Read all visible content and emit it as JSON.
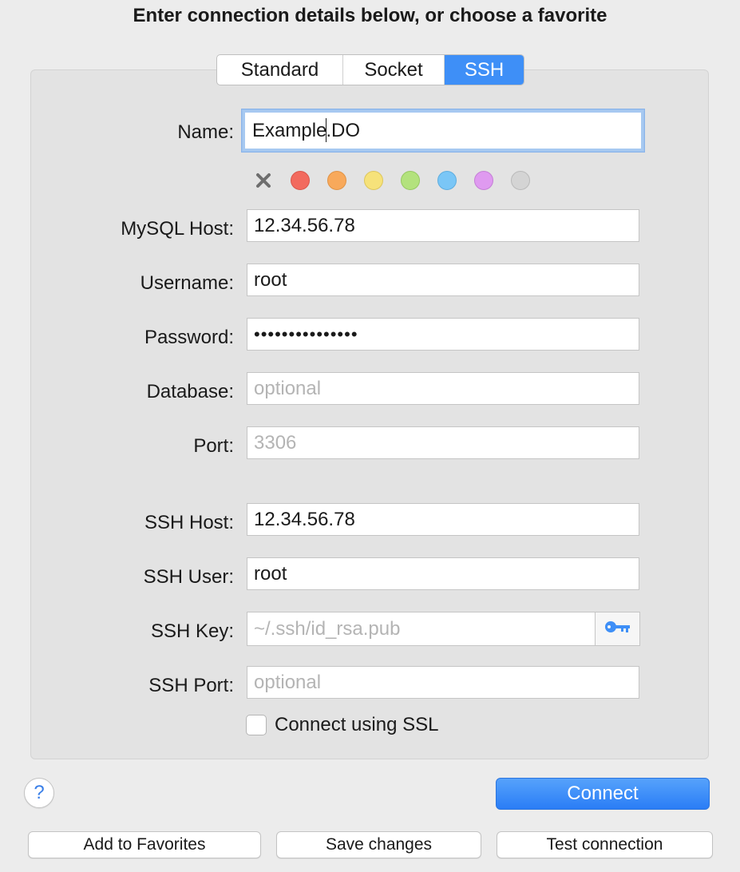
{
  "heading": "Enter connection details below, or choose a favorite",
  "tabs": [
    {
      "label": "Standard",
      "selected": false
    },
    {
      "label": "Socket",
      "selected": false
    },
    {
      "label": "SSH",
      "selected": true
    }
  ],
  "accent_color": "#3e8ff7",
  "form": {
    "name": {
      "label": "Name:",
      "value_before_caret": "Example",
      "value_after_caret": ".DO"
    },
    "colors": {
      "clear_icon": "close-icon",
      "swatches": [
        {
          "name": "red",
          "fill": "#f26a5e",
          "border": "#d9564b"
        },
        {
          "name": "orange",
          "fill": "#f8a95b",
          "border": "#e09346"
        },
        {
          "name": "yellow",
          "fill": "#f6e27a",
          "border": "#ddc65c"
        },
        {
          "name": "green",
          "fill": "#b3e27d",
          "border": "#97c862"
        },
        {
          "name": "blue",
          "fill": "#7ac6f6",
          "border": "#5eaddf"
        },
        {
          "name": "purple",
          "fill": "#df9af0",
          "border": "#c47fd6"
        },
        {
          "name": "gray",
          "fill": "#d4d4d4",
          "border": "#b9b9b9"
        }
      ]
    },
    "mysql_host": {
      "label": "MySQL Host:",
      "value": "12.34.56.78",
      "placeholder": ""
    },
    "username": {
      "label": "Username:",
      "value": "root",
      "placeholder": ""
    },
    "password": {
      "label": "Password:",
      "value": "•••••••••••••••",
      "placeholder": ""
    },
    "database": {
      "label": "Database:",
      "value": "",
      "placeholder": "optional"
    },
    "port": {
      "label": "Port:",
      "value": "",
      "placeholder": "3306"
    },
    "ssh_host": {
      "label": "SSH Host:",
      "value": "12.34.56.78",
      "placeholder": ""
    },
    "ssh_user": {
      "label": "SSH User:",
      "value": "root",
      "placeholder": ""
    },
    "ssh_key": {
      "label": "SSH Key:",
      "value": "",
      "placeholder": "~/.ssh/id_rsa.pub",
      "button_icon": "key-icon"
    },
    "ssh_port": {
      "label": "SSH Port:",
      "value": "",
      "placeholder": "optional"
    },
    "ssl": {
      "label": "Connect using SSL",
      "checked": false
    }
  },
  "buttons": {
    "help": "?",
    "connect": "Connect",
    "add_to_favorites": "Add to Favorites",
    "save_changes": "Save changes",
    "test_connection": "Test connection"
  }
}
